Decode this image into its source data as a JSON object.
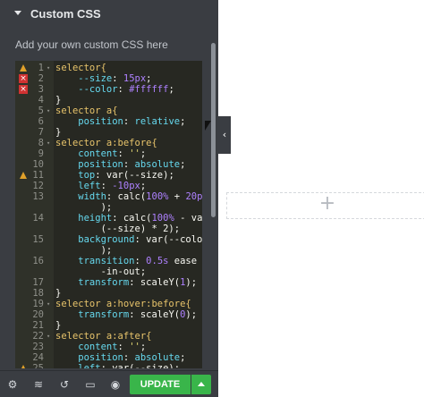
{
  "panel": {
    "section_title": "Custom CSS",
    "description": "Add your own custom CSS here"
  },
  "editor": {
    "lines": [
      {
        "num": "1",
        "marker": "warn",
        "fold": true,
        "code": [
          [
            "s",
            "selector{"
          ]
        ]
      },
      {
        "num": "2",
        "marker": "err",
        "fold": false,
        "code": [
          [
            "p",
            "    --size"
          ],
          [
            "w",
            ": "
          ],
          [
            "n",
            "15px"
          ],
          [
            "w",
            ";"
          ]
        ]
      },
      {
        "num": "3",
        "marker": "err",
        "fold": false,
        "code": [
          [
            "p",
            "    --color"
          ],
          [
            "w",
            ": "
          ],
          [
            "n",
            "#ffffff"
          ],
          [
            "w",
            ";"
          ]
        ]
      },
      {
        "num": "4",
        "marker": "",
        "fold": false,
        "code": [
          [
            "w",
            "}"
          ]
        ]
      },
      {
        "num": "5",
        "marker": "",
        "fold": true,
        "code": [
          [
            "s",
            "selector a{"
          ]
        ]
      },
      {
        "num": "6",
        "marker": "",
        "fold": false,
        "code": [
          [
            "p",
            "    position"
          ],
          [
            "w",
            ": "
          ],
          [
            "f",
            "relative"
          ],
          [
            "w",
            ";"
          ]
        ]
      },
      {
        "num": "7",
        "marker": "",
        "fold": false,
        "code": [
          [
            "w",
            "}"
          ]
        ]
      },
      {
        "num": "8",
        "marker": "",
        "fold": true,
        "code": [
          [
            "s",
            "selector a:before{"
          ]
        ]
      },
      {
        "num": "9",
        "marker": "",
        "fold": false,
        "code": [
          [
            "p",
            "    content"
          ],
          [
            "w",
            ": "
          ],
          [
            "str",
            "''"
          ],
          [
            "w",
            ";"
          ]
        ]
      },
      {
        "num": "10",
        "marker": "",
        "fold": false,
        "code": [
          [
            "p",
            "    position"
          ],
          [
            "w",
            ": "
          ],
          [
            "f",
            "absolute"
          ],
          [
            "w",
            ";"
          ]
        ]
      },
      {
        "num": "11",
        "marker": "warn",
        "fold": false,
        "code": [
          [
            "p",
            "    top"
          ],
          [
            "w",
            ": var(--size);"
          ]
        ]
      },
      {
        "num": "12",
        "marker": "",
        "fold": false,
        "code": [
          [
            "p",
            "    left"
          ],
          [
            "w",
            ": "
          ],
          [
            "n",
            "-10px"
          ],
          [
            "w",
            ";"
          ]
        ]
      },
      {
        "num": "13",
        "marker": "",
        "fold": false,
        "code": [
          [
            "p",
            "    width"
          ],
          [
            "w",
            ": calc("
          ],
          [
            "n",
            "100%"
          ],
          [
            "w",
            " + "
          ],
          [
            "n",
            "20px"
          ]
        ]
      },
      {
        "num": "",
        "marker": "",
        "fold": false,
        "code": [
          [
            "w",
            "        );"
          ]
        ]
      },
      {
        "num": "14",
        "marker": "",
        "fold": false,
        "code": [
          [
            "p",
            "    height"
          ],
          [
            "w",
            ": calc("
          ],
          [
            "n",
            "100%"
          ],
          [
            "w",
            " - var"
          ]
        ]
      },
      {
        "num": "",
        "marker": "",
        "fold": false,
        "code": [
          [
            "w",
            "        (--size) * 2);"
          ]
        ]
      },
      {
        "num": "15",
        "marker": "",
        "fold": false,
        "code": [
          [
            "p",
            "    background"
          ],
          [
            "w",
            ": var(--color"
          ]
        ]
      },
      {
        "num": "",
        "marker": "",
        "fold": false,
        "code": [
          [
            "w",
            "        );"
          ]
        ]
      },
      {
        "num": "16",
        "marker": "",
        "fold": false,
        "code": [
          [
            "p",
            "    transition"
          ],
          [
            "w",
            ": "
          ],
          [
            "n",
            "0.5s"
          ],
          [
            "w",
            " ease"
          ]
        ]
      },
      {
        "num": "",
        "marker": "",
        "fold": false,
        "code": [
          [
            "w",
            "        -in-out;"
          ]
        ]
      },
      {
        "num": "17",
        "marker": "",
        "fold": false,
        "code": [
          [
            "p",
            "    transform"
          ],
          [
            "w",
            ": scaleY("
          ],
          [
            "n",
            "1"
          ],
          [
            "w",
            ");"
          ]
        ]
      },
      {
        "num": "18",
        "marker": "",
        "fold": false,
        "code": [
          [
            "w",
            "}"
          ]
        ]
      },
      {
        "num": "19",
        "marker": "",
        "fold": true,
        "code": [
          [
            "s",
            "selector a:hover:before{"
          ]
        ]
      },
      {
        "num": "20",
        "marker": "",
        "fold": false,
        "code": [
          [
            "p",
            "    transform"
          ],
          [
            "w",
            ": scaleY("
          ],
          [
            "n",
            "0"
          ],
          [
            "w",
            ");"
          ]
        ]
      },
      {
        "num": "21",
        "marker": "",
        "fold": false,
        "code": [
          [
            "w",
            "}"
          ]
        ]
      },
      {
        "num": "22",
        "marker": "",
        "fold": true,
        "code": [
          [
            "s",
            "selector a:after{"
          ]
        ]
      },
      {
        "num": "23",
        "marker": "",
        "fold": false,
        "code": [
          [
            "p",
            "    content"
          ],
          [
            "w",
            ": "
          ],
          [
            "str",
            "''"
          ],
          [
            "w",
            ";"
          ]
        ]
      },
      {
        "num": "24",
        "marker": "",
        "fold": false,
        "code": [
          [
            "p",
            "    position"
          ],
          [
            "w",
            ": "
          ],
          [
            "f",
            "absolute"
          ],
          [
            "w",
            ";"
          ]
        ]
      },
      {
        "num": "25",
        "marker": "warn",
        "fold": false,
        "code": [
          [
            "p",
            "    left"
          ],
          [
            "w",
            ": var(--size);"
          ]
        ]
      }
    ]
  },
  "footer": {
    "update_label": "UPDATE",
    "icons": [
      "gear-icon",
      "layers-icon",
      "history-icon",
      "responsive-icon",
      "eye-icon"
    ]
  },
  "canvas": {
    "plus_glyph": "+",
    "collapse_glyph": "‹"
  },
  "colors": {
    "panel_bg": "#3a3d42",
    "editor_bg": "#272822",
    "accent_green": "#39b54a",
    "warning": "#e0a12a",
    "error": "#d03232"
  }
}
